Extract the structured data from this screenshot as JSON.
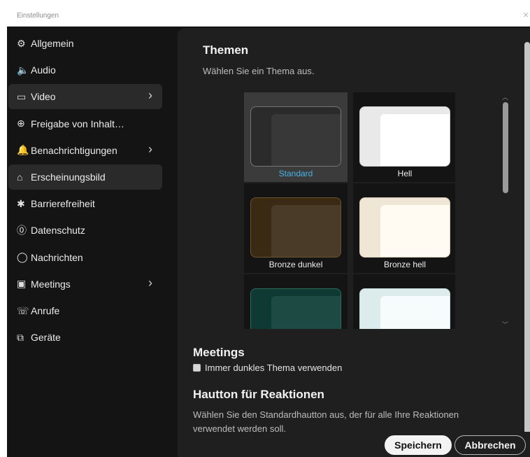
{
  "window": {
    "title": "Einstellungen",
    "close_icon": "×"
  },
  "sidebar": {
    "items": [
      {
        "label": "Allgemein",
        "icon": "⚙",
        "icon_name": "gear-icon",
        "chevron": false,
        "active": false
      },
      {
        "label": "Audio",
        "icon": "🔈",
        "icon_name": "speaker-icon",
        "chevron": false,
        "active": false
      },
      {
        "label": "Video",
        "icon": "▭",
        "icon_name": "video-camera-icon",
        "chevron": true,
        "active": true
      },
      {
        "label": "Freigabe von Inhalt…",
        "icon": "⊕",
        "icon_name": "share-screen-icon",
        "chevron": false,
        "active": false
      },
      {
        "label": "Benachrichtigungen",
        "icon": "🔔",
        "icon_name": "bell-icon",
        "chevron": true,
        "active": false
      },
      {
        "label": "Erscheinungsbild",
        "icon": "⌂",
        "icon_name": "appearance-icon",
        "chevron": false,
        "active": true
      },
      {
        "label": "Barrierefreiheit",
        "icon": "✱",
        "icon_name": "accessibility-icon",
        "chevron": false,
        "active": false
      },
      {
        "label": "Datenschutz",
        "icon": "⓪",
        "icon_name": "privacy-icon",
        "chevron": false,
        "active": false
      },
      {
        "label": "Nachrichten",
        "icon": "◯",
        "icon_name": "message-bubble-icon",
        "chevron": false,
        "active": false
      },
      {
        "label": "Meetings",
        "icon": "▣",
        "icon_name": "calendar-icon",
        "chevron": true,
        "active": false
      },
      {
        "label": "Anrufe",
        "icon": "☏",
        "icon_name": "phone-icon",
        "chevron": false,
        "active": false
      },
      {
        "label": "Geräte",
        "icon": "⧉",
        "icon_name": "devices-icon",
        "chevron": false,
        "active": false
      }
    ],
    "chevron_glyph": "›"
  },
  "themes_section": {
    "title": "Themen",
    "description": "Wählen Sie ein Thema aus.",
    "themes": [
      {
        "label": "Standard",
        "selected": true,
        "outer": "#2b2b2b",
        "inner": "#383838",
        "border": "#777777"
      },
      {
        "label": "Hell",
        "selected": false,
        "outer": "#e9e9e9",
        "inner": "#ffffff",
        "border": "#cfcfcf"
      },
      {
        "label": "Bronze dunkel",
        "selected": false,
        "outer": "#3a2a14",
        "inner": "#4a3a28",
        "border": "#6b5232"
      },
      {
        "label": "Bronze hell",
        "selected": false,
        "outer": "#f0e6d6",
        "inner": "#fffaf2",
        "border": "#d8ccb8"
      },
      {
        "label": "",
        "selected": false,
        "outer": "#0f3a33",
        "inner": "#1d4a43",
        "border": "#2d6b60"
      },
      {
        "label": "",
        "selected": false,
        "outer": "#dcecec",
        "inner": "#f6fbfb",
        "border": "#c4dcdc"
      }
    ]
  },
  "meetings_section": {
    "title": "Meetings",
    "checkbox_label": "Immer dunkles Thema verwenden",
    "checked": false
  },
  "skin_section": {
    "title": "Hautton für Reaktionen",
    "description": "Wählen Sie den Standardhautton aus, der für alle Ihre Reaktionen",
    "description_cut": "verwendet werden soll."
  },
  "footer": {
    "save_label": "Speichern",
    "cancel_label": "Abbrechen"
  },
  "colors": {
    "accent_selected_theme": "#4ab2e8",
    "window_bg": "#121212",
    "content_bg": "#1f1f1f"
  }
}
